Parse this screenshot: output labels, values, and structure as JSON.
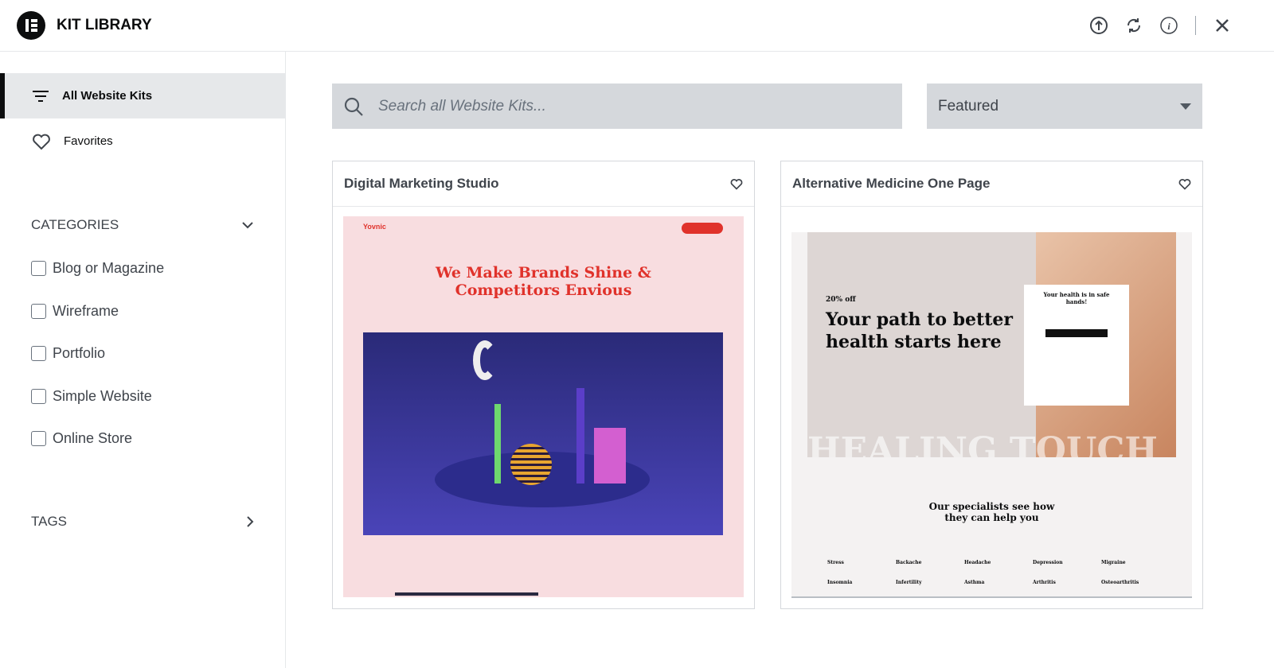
{
  "header": {
    "title": "KIT LIBRARY",
    "icons": [
      "import-icon",
      "sync-icon",
      "info-icon",
      "close-icon"
    ]
  },
  "sidebar": {
    "items": [
      {
        "label": "All Website Kits",
        "icon": "filter-icon",
        "active": true
      },
      {
        "label": "Favorites",
        "icon": "heart-icon",
        "active": false
      }
    ],
    "categories_label": "CATEGORIES",
    "categories": [
      {
        "label": "Blog or Magazine",
        "checked": false
      },
      {
        "label": "Wireframe",
        "checked": false
      },
      {
        "label": "Portfolio",
        "checked": false
      },
      {
        "label": "Simple Website",
        "checked": false
      },
      {
        "label": "Online Store",
        "checked": false
      }
    ],
    "tags_label": "TAGS"
  },
  "search": {
    "placeholder": "Search all Website Kits..."
  },
  "sort": {
    "selected": "Featured"
  },
  "kits": [
    {
      "title": "Digital Marketing Studio",
      "preview": {
        "logo": "Yovnic",
        "headline1": "We Make Brands Shine &",
        "headline2": "Competitors Envious",
        "accent": "#e0322b",
        "bg": "#f8dde0"
      }
    },
    {
      "title": "Alternative Medicine One Page",
      "preview": {
        "promo": "20% off",
        "headline1": "Your path to better",
        "headline2": "health starts here",
        "form_title": "Your health is in safe hands!",
        "big_text": "HEALING TOUCH",
        "section1": "Our specialists see how",
        "section2": "they can help you",
        "conditions": [
          "Stress",
          "Backache",
          "Headache",
          "Depression",
          "Migraine",
          "Insomnia",
          "Infertility",
          "Asthma",
          "Arthritis",
          "Osteoarthritis"
        ]
      }
    }
  ]
}
